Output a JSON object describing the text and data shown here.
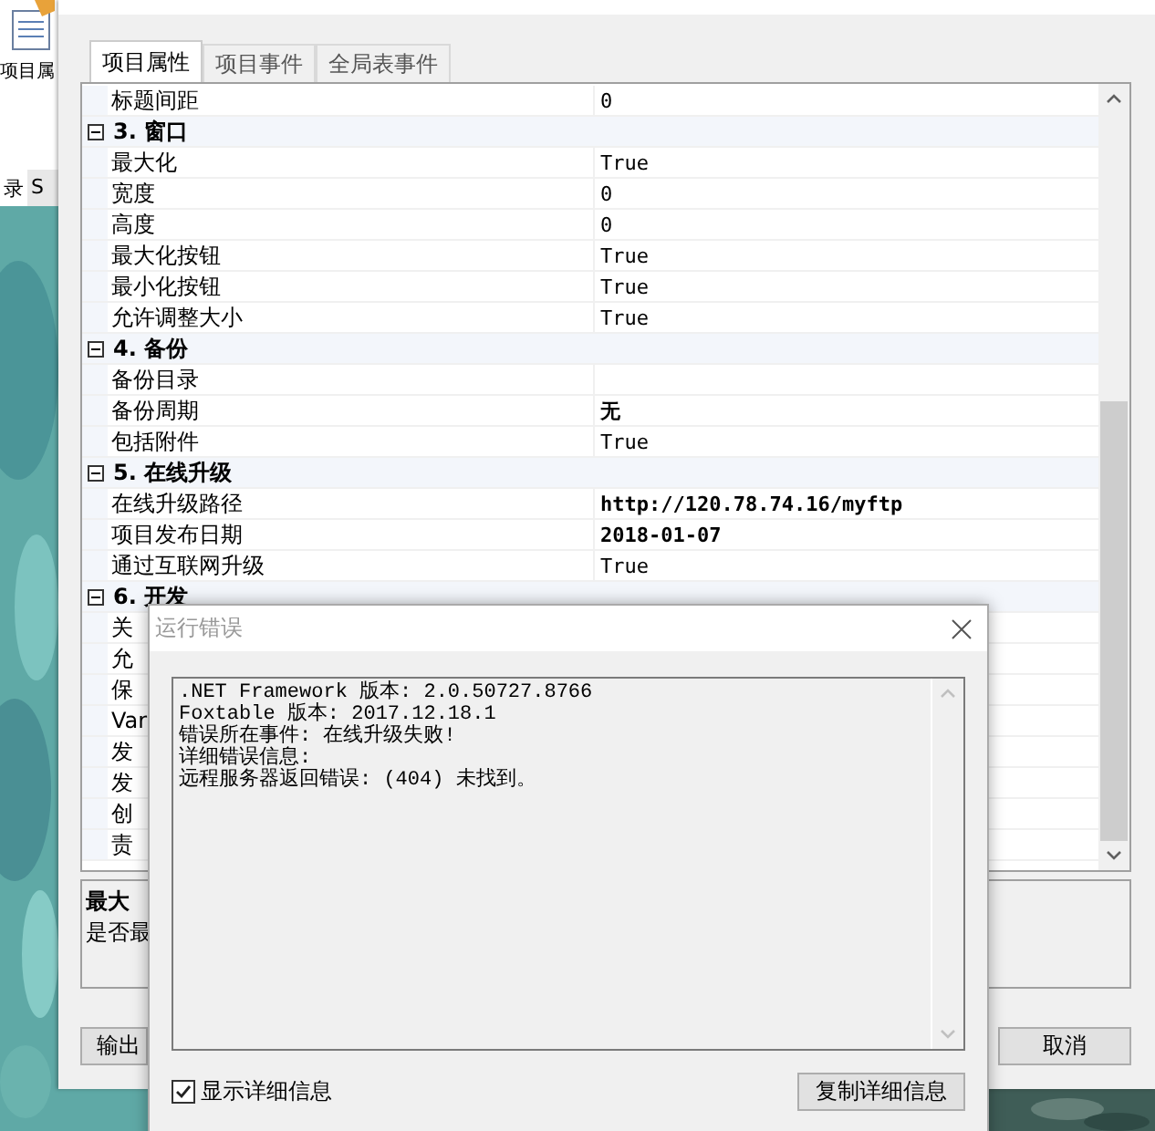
{
  "background_app": {
    "label": "项目属",
    "tabs": [
      {
        "label": "录",
        "selected": true
      },
      {
        "label": "S",
        "selected": false
      }
    ]
  },
  "main_window": {
    "tabs": [
      {
        "label": "项目属性",
        "selected": true
      },
      {
        "label": "项目事件",
        "selected": false
      },
      {
        "label": "全局表事件",
        "selected": false
      }
    ],
    "properties": [
      {
        "kind": "row",
        "name": "标题间距",
        "value": "0",
        "modified": false
      },
      {
        "kind": "group",
        "name": "3. 窗口",
        "expanded": true
      },
      {
        "kind": "row",
        "name": "最大化",
        "value": "True",
        "modified": false
      },
      {
        "kind": "row",
        "name": "宽度",
        "value": "0",
        "modified": false
      },
      {
        "kind": "row",
        "name": "高度",
        "value": "0",
        "modified": false
      },
      {
        "kind": "row",
        "name": "最大化按钮",
        "value": "True",
        "modified": false
      },
      {
        "kind": "row",
        "name": "最小化按钮",
        "value": "True",
        "modified": false
      },
      {
        "kind": "row",
        "name": "允许调整大小",
        "value": "True",
        "modified": false
      },
      {
        "kind": "group",
        "name": "4. 备份",
        "expanded": true
      },
      {
        "kind": "row",
        "name": "备份目录"
      },
      {
        "kind": "row",
        "name": "备份周期",
        "value": "无",
        "modified": true
      },
      {
        "kind": "row",
        "name": "包括附件",
        "value": "True",
        "modified": false
      },
      {
        "kind": "group",
        "name": "5. 在线升级",
        "expanded": true
      },
      {
        "kind": "row",
        "name": "在线升级路径",
        "value": "http://120.78.74.16/myftp",
        "modified": true
      },
      {
        "kind": "row",
        "name": "项目发布日期",
        "value": "2018-01-07",
        "modified": true
      },
      {
        "kind": "row",
        "name": "通过互联网升级",
        "value": "True",
        "modified": false
      },
      {
        "kind": "group",
        "name": "6. 开发",
        "expanded": true
      },
      {
        "kind": "row",
        "name": "关"
      },
      {
        "kind": "row",
        "name": "允"
      },
      {
        "kind": "row",
        "name": "保"
      },
      {
        "kind": "row",
        "name": "Var"
      },
      {
        "kind": "row",
        "name": "发"
      },
      {
        "kind": "row",
        "name": "发"
      },
      {
        "kind": "row",
        "name": "创"
      },
      {
        "kind": "row",
        "name": "责"
      }
    ],
    "description": {
      "title": "最大",
      "text": "是否最"
    },
    "buttons": [
      {
        "label": "输出"
      },
      {
        "label": "取消"
      }
    ]
  },
  "error_dialog": {
    "title": "运行错误",
    "details": [
      ".NET Framework 版本: 2.0.50727.8766",
      "Foxtable 版本: 2017.12.18.1",
      "错误所在事件: 在线升级失败!",
      "详细错误信息:",
      "远程服务器返回错误: (404) 未找到。"
    ],
    "show_details": {
      "label": "显示详细信息",
      "checked": true
    },
    "copy_button": "复制详细信息"
  }
}
